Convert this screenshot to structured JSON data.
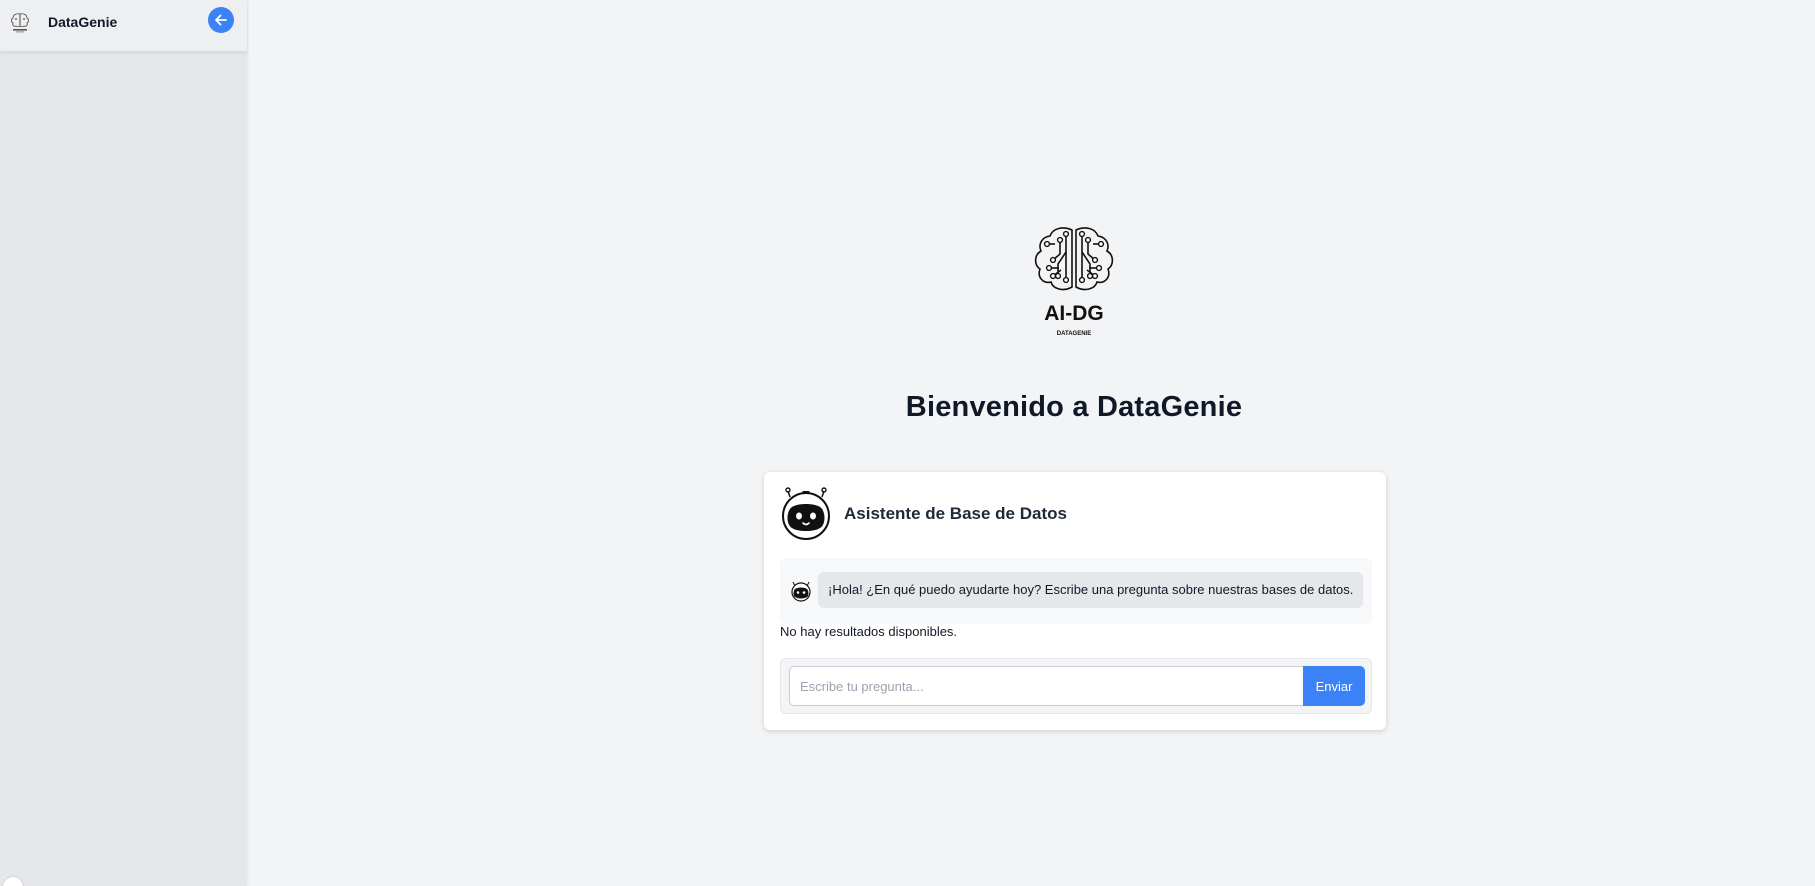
{
  "sidebar": {
    "app_name": "DataGenie",
    "logo_icon": "brain-circuit-icon",
    "collapse_icon": "arrow-left-icon"
  },
  "main": {
    "logo": {
      "icon": "brain-circuit-logo",
      "wordmark": "AI-DG",
      "subtext": "DATAGENIE"
    },
    "welcome_title": "Bienvenido a DataGenie"
  },
  "assistant": {
    "title": "Asistente de Base de Datos",
    "avatar_icon": "robot-icon",
    "messages": [
      {
        "sender": "bot",
        "text": "¡Hola! ¿En qué puedo ayudarte hoy? Escribe una pregunta sobre nuestras bases de datos."
      }
    ],
    "no_results": "No hay resultados disponibles.",
    "input_value": "",
    "input_placeholder": "Escribe tu pregunta...",
    "send_label": "Enviar"
  },
  "colors": {
    "accent": "#3b82f6",
    "background": "#f3f4f6",
    "sidebar": "#e5e7eb",
    "bubble": "#e5e7eb"
  }
}
